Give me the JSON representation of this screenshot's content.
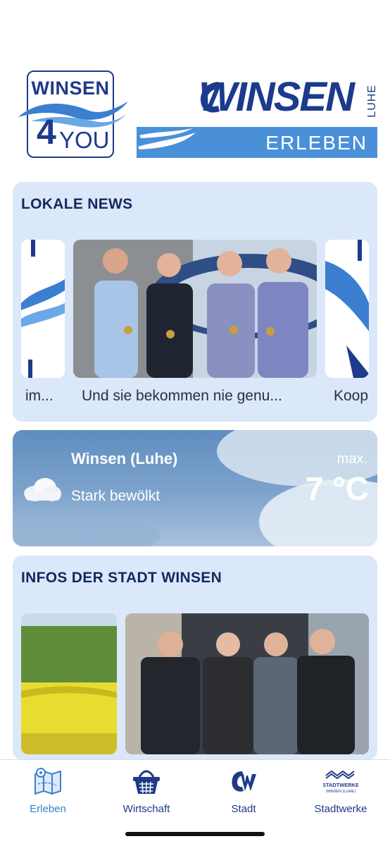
{
  "header": {
    "left_logo": {
      "top": "WINSEN",
      "four": "4",
      "you": "YOU"
    },
    "right_logo": {
      "word": "WINSEN",
      "luhe": "LUHE",
      "bar": "ERLEBEN"
    }
  },
  "news": {
    "title": "LOKALE NEWS",
    "items": [
      {
        "caption": "im..."
      },
      {
        "caption": "Und sie bekommen nie genu..."
      },
      {
        "caption": "Koop"
      }
    ]
  },
  "weather": {
    "city": "Winsen (Luhe)",
    "condition": "Stark bewölkt",
    "max_label": "max.",
    "temp": "7 °C",
    "icon": "cloud-icon"
  },
  "infos": {
    "title": "INFOS DER STADT WINSEN"
  },
  "nav": {
    "items": [
      {
        "label": "Erleben",
        "icon": "map-icon",
        "active": true
      },
      {
        "label": "Wirtschaft",
        "icon": "basket-icon",
        "active": false
      },
      {
        "label": "Stadt",
        "icon": "cw-logo-icon",
        "active": false
      },
      {
        "label": "Stadtwerke",
        "icon": "stadtwerke-logo-icon",
        "active": false
      }
    ],
    "stadtwerke_logo_text": [
      "STADTWERKE",
      "WINSEN (LUHE)"
    ]
  },
  "colors": {
    "card_bg": "#dbe8fa",
    "brand_dark": "#1b3b8c",
    "brand_light": "#4a90d9",
    "active_nav": "#3a7fd0"
  }
}
